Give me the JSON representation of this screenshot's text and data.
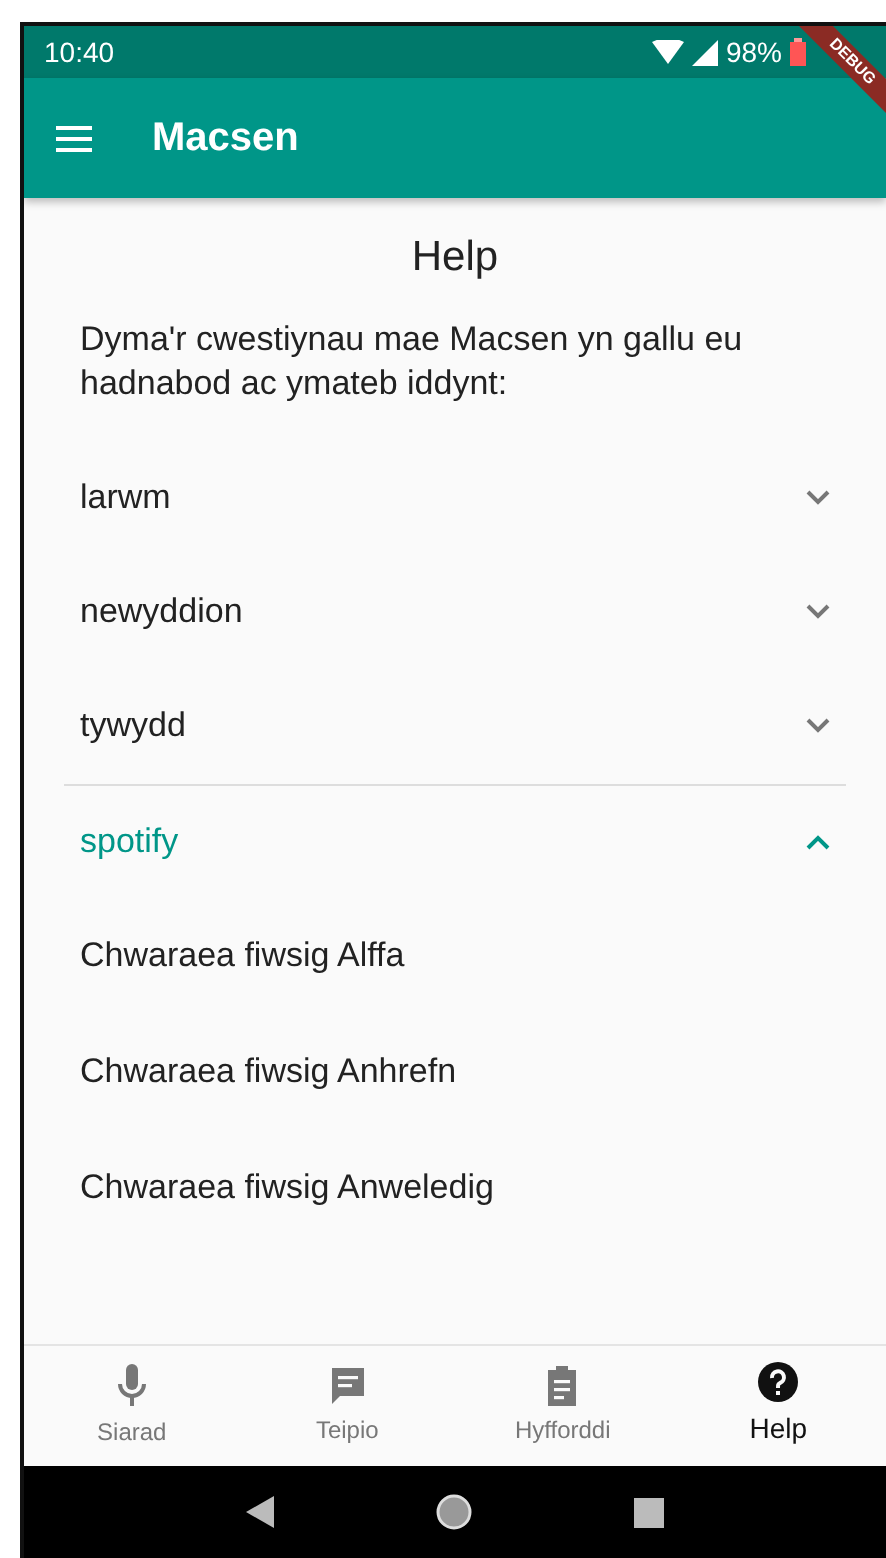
{
  "status_bar": {
    "time": "10:40",
    "battery": "98%"
  },
  "debug_banner": "DEBUG",
  "app_bar": {
    "title": "Macsen"
  },
  "page": {
    "title": "Help",
    "intro": "Dyma'r cwestiynau mae Macsen yn gallu eu hadnabod ac ymateb iddynt:"
  },
  "sections": [
    {
      "title": "larwm",
      "expanded": false
    },
    {
      "title": "newyddion",
      "expanded": false
    },
    {
      "title": "tywydd",
      "expanded": false
    },
    {
      "title": "spotify",
      "expanded": true,
      "items": [
        "Chwaraea fiwsig Alffa",
        "Chwaraea fiwsig Anhrefn",
        "Chwaraea fiwsig Anweledig"
      ]
    }
  ],
  "bottom_nav": [
    {
      "kind": "mic",
      "label": "Siarad",
      "selected": false
    },
    {
      "kind": "message",
      "label": "Teipio",
      "selected": false
    },
    {
      "kind": "clipboard",
      "label": "Hyfforddi",
      "selected": false
    },
    {
      "kind": "help",
      "label": "Help",
      "selected": true
    }
  ]
}
